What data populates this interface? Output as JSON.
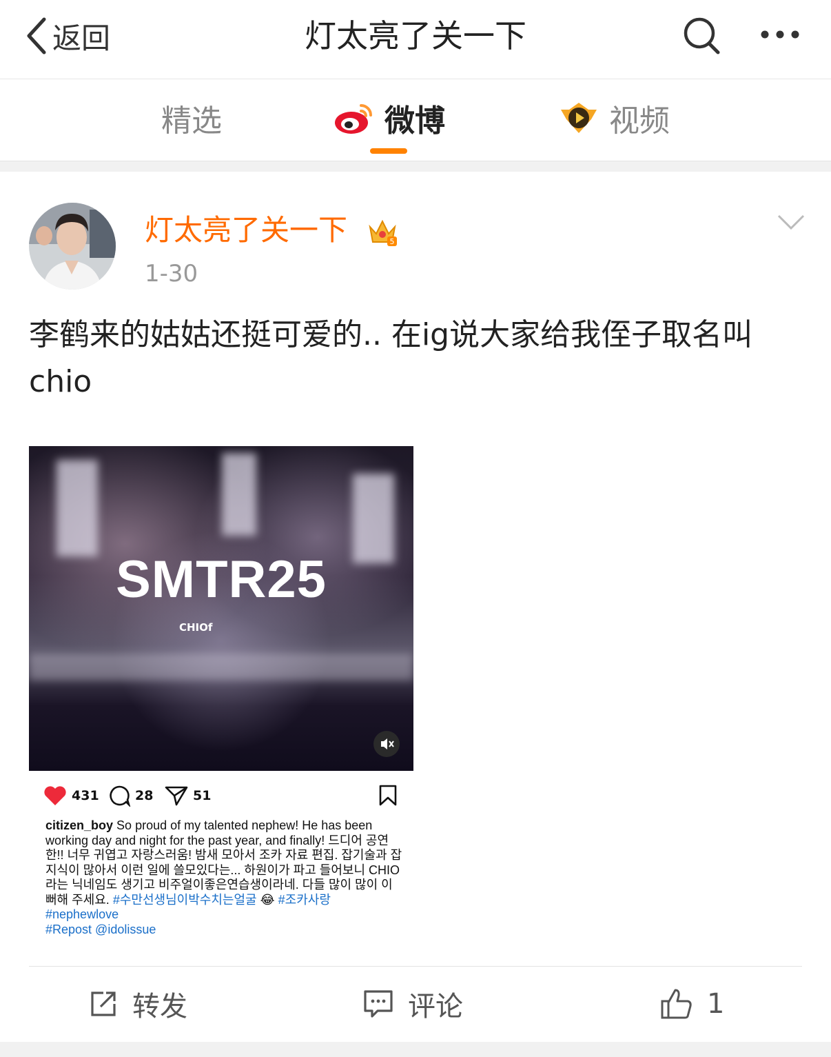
{
  "header": {
    "back_label": "返回",
    "title": "灯太亮了关一下"
  },
  "tabs": [
    {
      "label": "精选",
      "active": false,
      "icon": ""
    },
    {
      "label": "微博",
      "active": true,
      "icon": "weibo-logo-icon"
    },
    {
      "label": "视频",
      "active": false,
      "icon": "video-channel-icon"
    }
  ],
  "colors": {
    "accent": "#ff8200",
    "author": "#ff6a00",
    "hashtag": "#1a6fc9"
  },
  "post": {
    "author": "灯太亮了关一下",
    "time": "1-30",
    "text": "李鹤来的姑姑还挺可爱的.. 在ig说大家给我侄子取名叫chio",
    "image": {
      "overlay_title": "SMTR25",
      "overlay_sub": "CHIOf",
      "likes": "431",
      "comments": "28",
      "shares": "51",
      "caption_user": "citizen_boy",
      "caption_text": "So proud of my talented nephew! He has been working day and night for the past year, and finally! 드디어 공연한!! 너무 귀엽고 자랑스러움! 밤새 모아서 조카 자료 편집. 잡기술과 잡지식이 많아서 이런 일에 쓸모있다는... 하원이가 파고 들어보니 CHIO라는 닉네임도 생기고 비주얼이좋은연습생이라네. 다들 많이 많이 이뻐해 주세요.",
      "caption_tags_1": "#수만선생님이박수치는얼굴",
      "caption_emoji": "😂",
      "caption_tags_2": "#조카사랑",
      "caption_tags_3": "#nephewlove",
      "caption_tags_4": "#Repost @idolissue"
    },
    "actions": {
      "repost_label": "转发",
      "comment_label": "评论",
      "like_count": "1"
    }
  }
}
